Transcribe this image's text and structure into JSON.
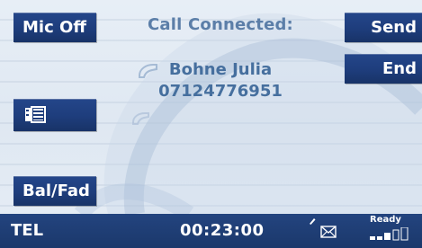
{
  "buttons": {
    "mic_off": "Mic Off",
    "send": "Send",
    "end": "End",
    "bal_fad": "Bal/Fad"
  },
  "call": {
    "title": "Call Connected:",
    "caller_name": "Bohne Julia",
    "caller_number": "07124776951"
  },
  "status_bar": {
    "mode": "TEL",
    "duration": "00:23:00",
    "ready_label": "Ready",
    "signal_level": 0.6,
    "icons": [
      "phonebook-icon",
      "envelope-icon",
      "pen-icon",
      "signal-strength-icon"
    ]
  },
  "colors": {
    "button_blue": "#1e3d7c",
    "status_bar": "#1d3a70",
    "text_blue": "#4f76a3",
    "background": "#e3ebf4"
  }
}
